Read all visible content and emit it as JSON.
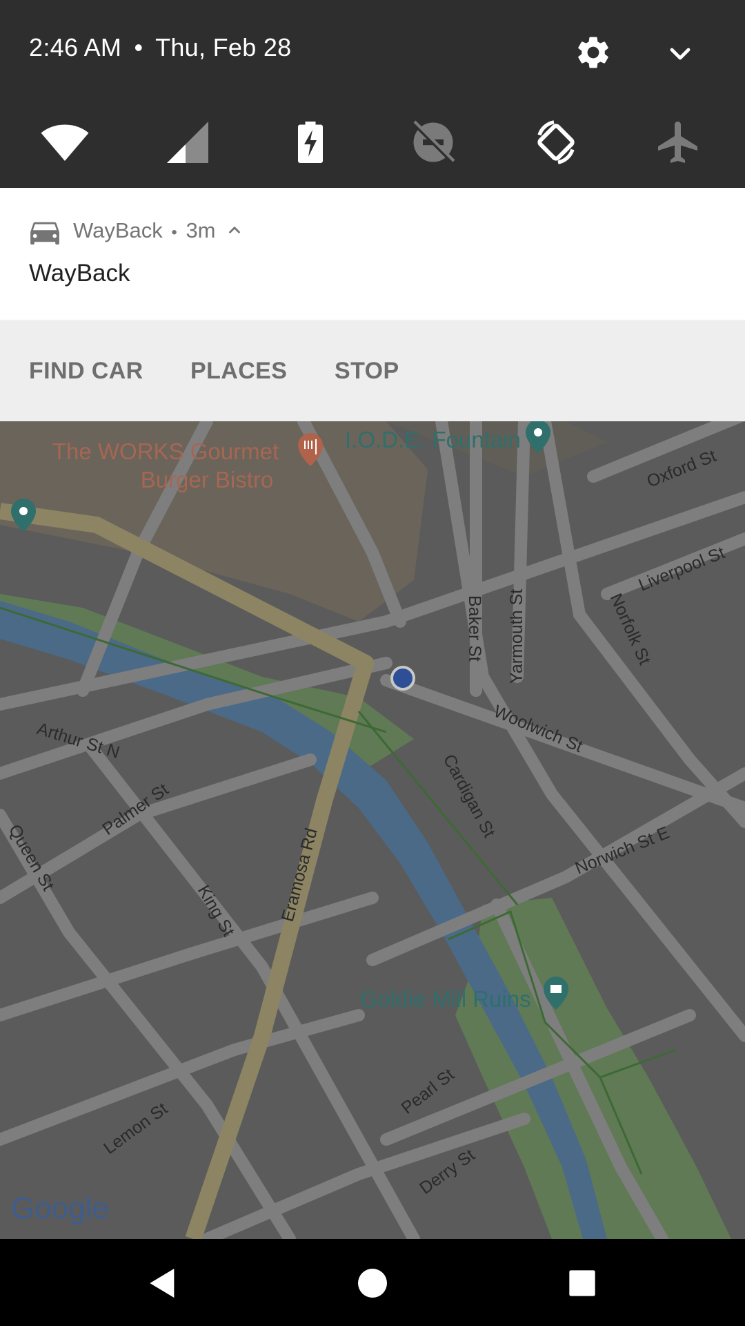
{
  "status": {
    "time": "2:46 AM",
    "separator": "•",
    "date": "Thu, Feb 28"
  },
  "quick_settings": {
    "icons": [
      "wifi-icon",
      "cell-signal-icon",
      "battery-charging-icon",
      "do-not-disturb-off-icon",
      "auto-rotate-icon",
      "airplane-mode-icon"
    ],
    "settings_icon": "gear-icon",
    "expand_icon": "chevron-down-icon"
  },
  "notification": {
    "app_name": "WayBack",
    "time_ago": "3m",
    "header_sep": "•",
    "title": "WayBack",
    "app_icon": "car-icon",
    "expand_icon": "chevron-up-icon",
    "actions": [
      "FIND CAR",
      "PLACES",
      "STOP"
    ]
  },
  "map": {
    "places": {
      "restaurant_line1": "The WORKS Gourmet",
      "restaurant_line2": "Burger Bistro",
      "fountain": "I.O.D.E. Fountain",
      "ruins": "Goldie Mill Ruins"
    },
    "streets": {
      "oxford": "Oxford St",
      "liverpool": "Liverpool St",
      "norfolk": "Norfolk St",
      "yarmouth": "Yarmouth St",
      "baker": "Baker St",
      "woolwich": "Woolwich St",
      "cardigan": "Cardigan St",
      "arthur": "Arthur St N",
      "palmer": "Palmer St",
      "queen": "Queen St",
      "king": "King St",
      "eramosa": "Eramosa Rd",
      "norwich": "Norwich St E",
      "pearl": "Pearl St",
      "lemon": "Lemon St",
      "derry": "Derry St"
    },
    "attribution": "Google",
    "colors": {
      "water": "#4a6a88",
      "park": "#5f7a55",
      "road": "#7e7e7e",
      "major_road": "#8c8462",
      "location": "#2e4f96"
    }
  },
  "navbar": {
    "icons": [
      "back-icon",
      "home-icon",
      "recents-icon"
    ]
  }
}
